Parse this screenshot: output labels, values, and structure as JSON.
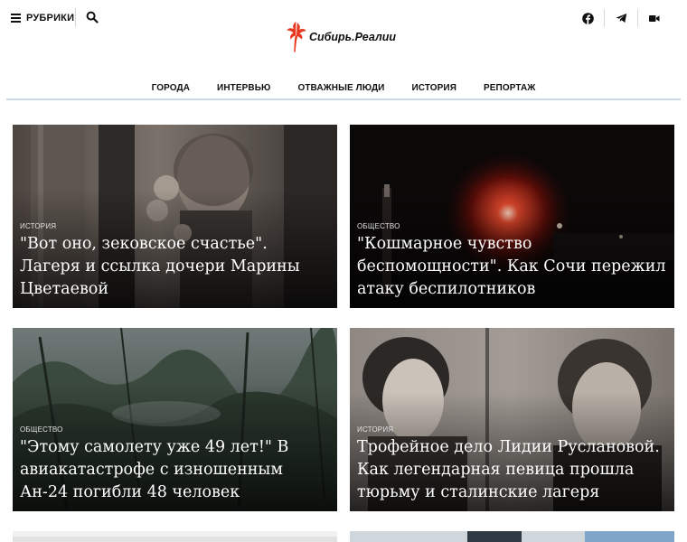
{
  "header": {
    "menu_label": "РУБРИКИ",
    "logo_text": "Сибирь.Реалии",
    "brand_color": "#e8371f"
  },
  "nav": {
    "items": [
      "ГОРОДА",
      "ИНТЕРВЬЮ",
      "ОТВАЖНЫЕ ЛЮДИ",
      "ИСТОРИЯ",
      "РЕПОРТАЖ"
    ]
  },
  "icons": {
    "menu": "hamburger-icon",
    "search": "search-icon",
    "facebook": "facebook-icon",
    "telegram": "telegram-icon",
    "video": "video-icon"
  },
  "cards": [
    {
      "category": "ИСТОРИЯ",
      "title": "\"Вот оно, зековское счастье\". Лагеря и ссылка дочери Марины Цветаевой"
    },
    {
      "category": "ОБЩЕСТВО",
      "title": "\"Кошмарное чувство беспомощности\". Как Сочи пережил атаку беспилотников"
    },
    {
      "category": "ОБЩЕСТВО",
      "title": "\"Этому самолету уже 49 лет!\" В авиакатастрофе с изношенным Ан-24 погибли 48 человек"
    },
    {
      "category": "ИСТОРИЯ",
      "title": "Трофейное дело Лидии Руслановой. Как легендарная певица прошла тюрьму и сталинские лагеря"
    }
  ]
}
